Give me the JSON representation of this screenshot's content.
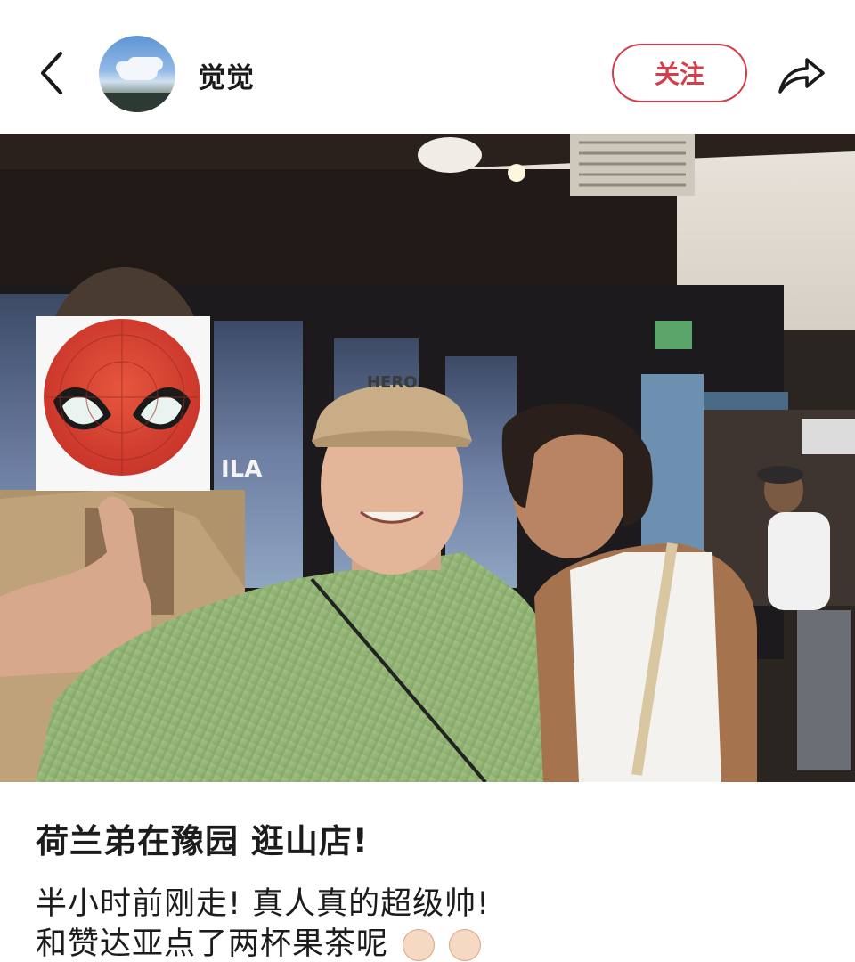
{
  "header": {
    "username": "觉觉",
    "follow_label": "关注",
    "back_icon": "chevron-left-icon",
    "share_icon": "share-arrow-icon",
    "accent_color": "#d63d4a"
  },
  "photo": {
    "storefront_sign": "ILA",
    "cap_text": "HERO",
    "sticker": "spiderman-mask-sticker"
  },
  "post": {
    "title": "荷兰弟在豫园 逛山店!",
    "line1": "半小时前刚走! 真人真的超级帅!",
    "line2_partial": "和赞达亚点了两杯果茶呢"
  }
}
